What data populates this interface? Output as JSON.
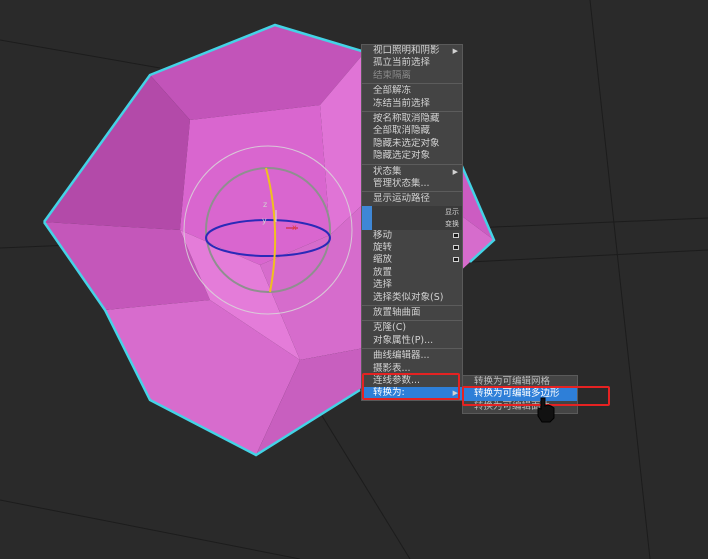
{
  "quad_menu": {
    "items": [
      {
        "label": "视口照明和阴影",
        "submenu": true
      },
      {
        "label": "孤立当前选择"
      },
      {
        "label": "结束隔离",
        "disabled": true
      },
      {
        "sep": true
      },
      {
        "label": "全部解冻"
      },
      {
        "label": "冻结当前选择"
      },
      {
        "sep": true
      },
      {
        "label": "按名称取消隐藏"
      },
      {
        "label": "全部取消隐藏"
      },
      {
        "label": "隐藏未选定对象"
      },
      {
        "label": "隐藏选定对象"
      },
      {
        "sep": true
      },
      {
        "label": "状态集",
        "submenu": true
      },
      {
        "label": "管理状态集..."
      },
      {
        "sep": true
      },
      {
        "label": "显示运动路径"
      }
    ],
    "bars": [
      {
        "tag": "显示"
      },
      {
        "tag": "变换"
      }
    ],
    "items2": [
      {
        "label": "移动",
        "box": true
      },
      {
        "label": "旋转",
        "box": true
      },
      {
        "label": "缩放",
        "box": true
      },
      {
        "label": "放置"
      },
      {
        "label": "选择"
      },
      {
        "label": "选择类似对象(S)"
      },
      {
        "sep": true
      },
      {
        "label": "放置轴曲面"
      },
      {
        "sep": true
      },
      {
        "label": "克隆(C)"
      },
      {
        "label": "对象属性(P)..."
      },
      {
        "sep": true
      },
      {
        "label": "曲线编辑器..."
      },
      {
        "label": "摄影表..."
      },
      {
        "label": "连线参数..."
      },
      {
        "label": "转换为:",
        "submenu": true,
        "highlight": true
      }
    ]
  },
  "submenu": {
    "items": [
      {
        "label": "转换为可编辑网格"
      },
      {
        "label": "转换为可编辑多边形",
        "highlight": true
      },
      {
        "label": "转换为可编辑面片"
      }
    ]
  },
  "gizmo": {
    "axis_z": "z",
    "axis_y": "y",
    "axis_x": "x"
  },
  "colors": {
    "object": "#d35fc9",
    "selection_outline": "#44d3e6",
    "highlight": "#2e7fd8",
    "annotation": "#e52222"
  }
}
